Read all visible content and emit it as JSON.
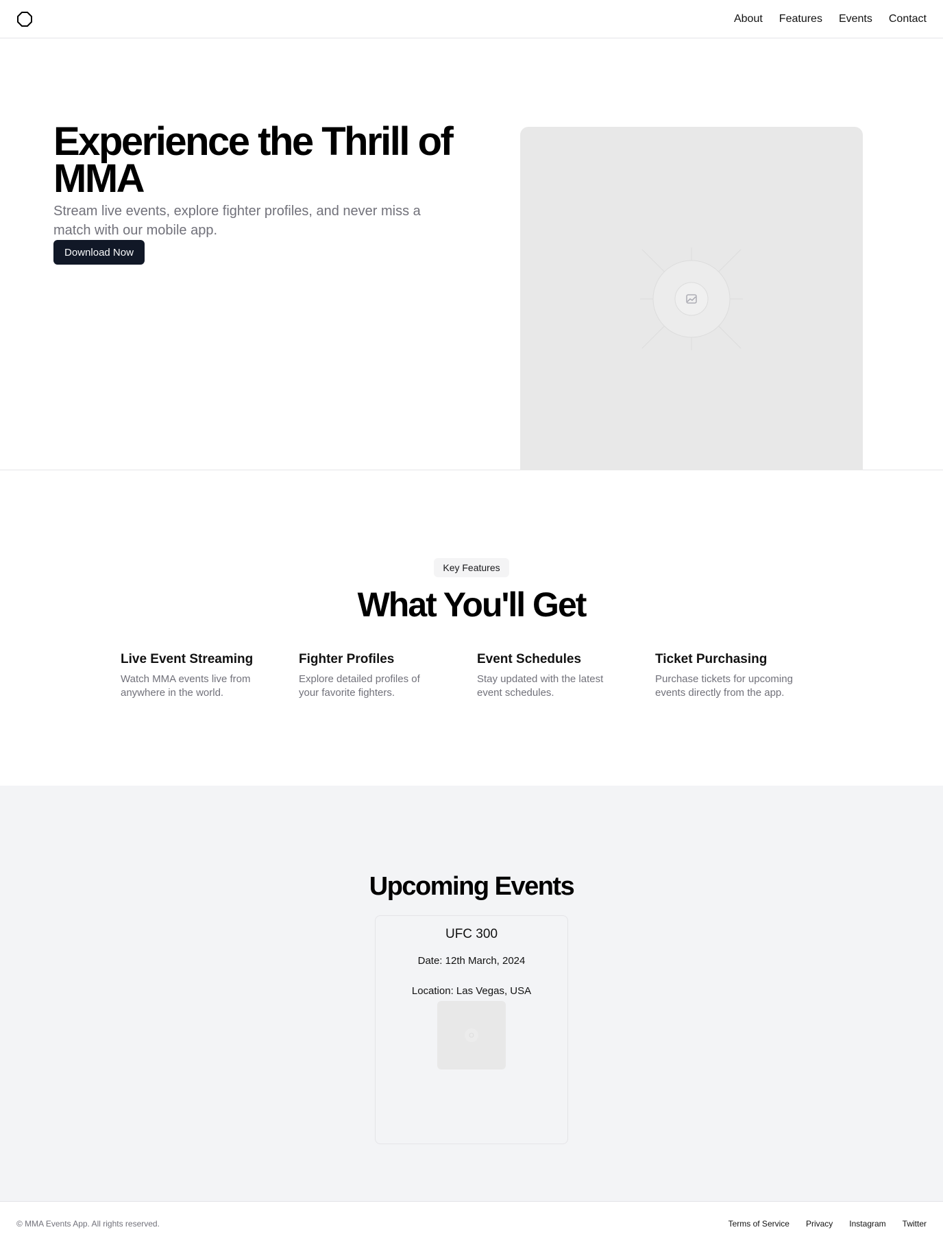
{
  "header": {
    "logo_icon": "octagon-logo-icon",
    "nav": [
      "About",
      "Features",
      "Events",
      "Contact"
    ]
  },
  "hero": {
    "title": "Experience the Thrill of MMA",
    "subtitle": "Stream live events, explore fighter profiles, and never miss a match with our mobile app.",
    "button_label": "Download Now",
    "image_icon": "image-placeholder-icon"
  },
  "features": {
    "badge": "Key Features",
    "title": "What You'll Get",
    "items": [
      {
        "title": "Live Event Streaming",
        "description": "Watch MMA events live from anywhere in the world."
      },
      {
        "title": "Fighter Profiles",
        "description": "Explore detailed profiles of your favorite fighters."
      },
      {
        "title": "Event Schedules",
        "description": "Stay updated with the latest event schedules."
      },
      {
        "title": "Ticket Purchasing",
        "description": "Purchase tickets for upcoming events directly from the app."
      }
    ]
  },
  "events": {
    "title": "Upcoming Events",
    "cards": [
      {
        "name": "UFC 300",
        "date": "Date: 12th March, 2024",
        "location": "Location: Las Vegas, USA"
      }
    ]
  },
  "footer": {
    "copyright": "© MMA Events App. All rights reserved.",
    "links": [
      "Terms of Service",
      "Privacy",
      "Instagram",
      "Twitter"
    ]
  },
  "colors": {
    "primary_button": "#111827",
    "muted_text": "#71717a",
    "events_background": "#f3f4f6",
    "placeholder": "#e8e8e8"
  }
}
